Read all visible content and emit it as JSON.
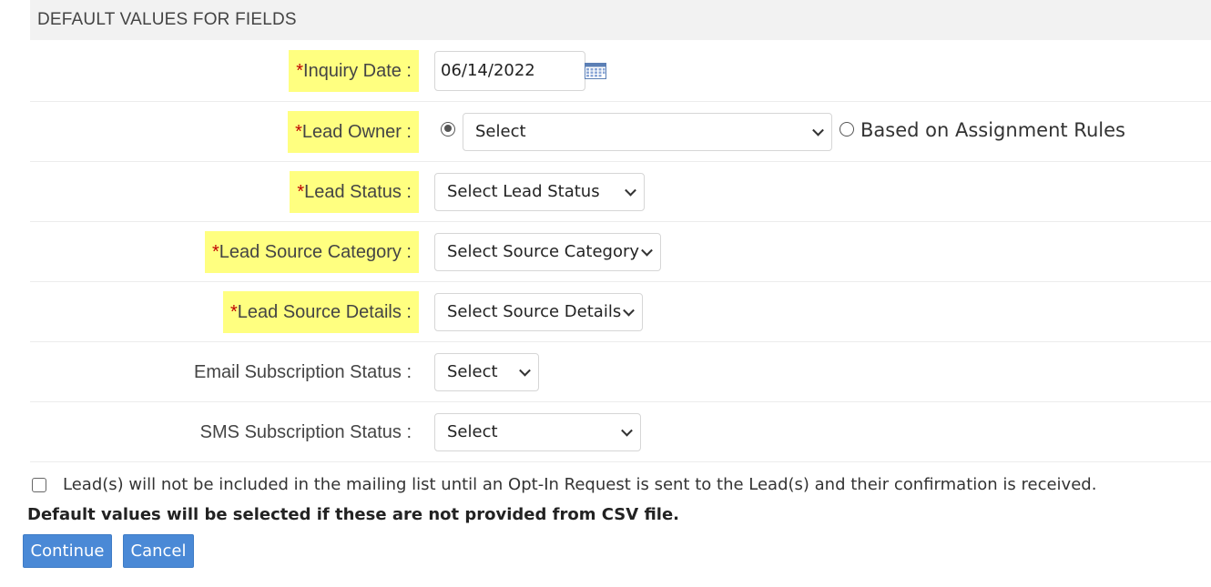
{
  "section": {
    "title": "DEFAULT VALUES FOR FIELDS"
  },
  "fields": {
    "inquiry_date": {
      "required_mark": "*",
      "label": "Inquiry Date :",
      "value": "06/14/2022",
      "icon": "calendar-icon"
    },
    "lead_owner": {
      "required_mark": "*",
      "label": "Lead Owner :",
      "select_value": "Select",
      "alt_option_label": "Based on Assignment Rules"
    },
    "lead_status": {
      "required_mark": "*",
      "label": "Lead Status :",
      "select_value": "Select Lead Status"
    },
    "lead_source_category": {
      "required_mark": "*",
      "label": "Lead Source Category :",
      "select_value": "Select Source Category"
    },
    "lead_source_details": {
      "required_mark": "*",
      "label": "Lead Source Details :",
      "select_value": "Select Source Details"
    },
    "email_subscription_status": {
      "label": "Email Subscription Status :",
      "select_value": "Select"
    },
    "sms_subscription_status": {
      "label": "SMS Subscription Status :",
      "select_value": "Select"
    }
  },
  "optin": {
    "text": "Lead(s) will not be included in the mailing list until an Opt-In Request is sent to the Lead(s) and their confirmation is received.",
    "checked": false
  },
  "note": "Default values will be selected if these are not provided from CSV file.",
  "buttons": {
    "continue": "Continue",
    "cancel": "Cancel"
  },
  "colors": {
    "highlight": "#ffff80",
    "required": "#c00000",
    "button": "#4a89d6",
    "header_bg": "#f2f2f2"
  }
}
